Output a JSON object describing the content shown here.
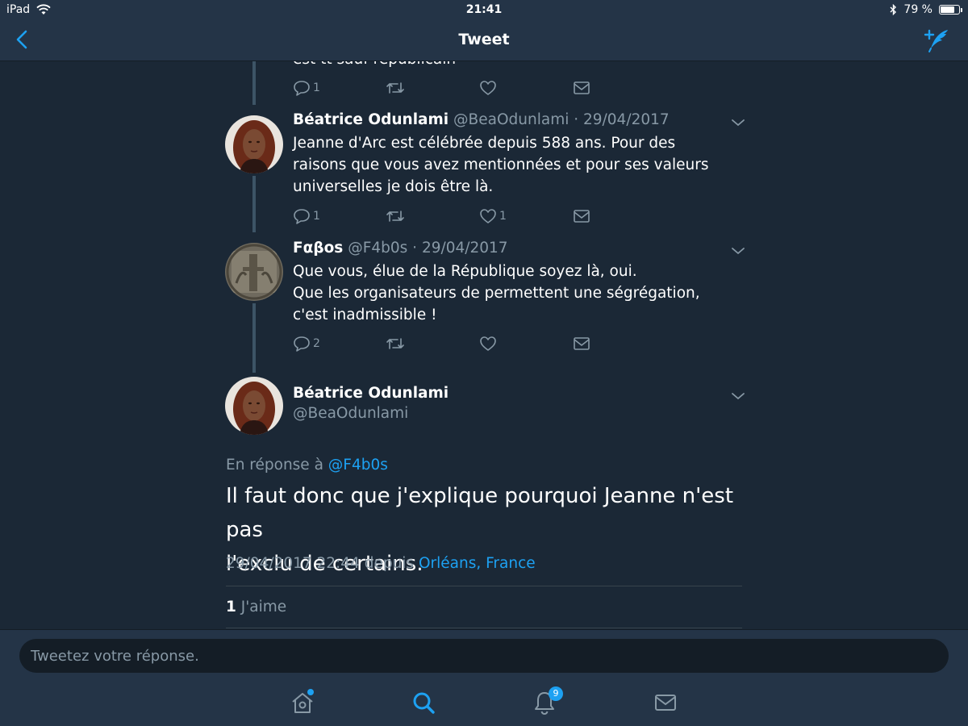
{
  "status_bar": {
    "device": "iPad",
    "time": "21:41",
    "battery": "79 %",
    "battery_level": 0.79
  },
  "nav": {
    "title": "Tweet",
    "back_icon": "chevron-left-icon",
    "compose_icon": "compose-tweet-icon"
  },
  "thread": {
    "partial_tweet": {
      "text": "est tt sauf républicain",
      "replies": "1",
      "retweets": "",
      "likes": ""
    },
    "tweets": [
      {
        "name": "Béatrice Odunlami",
        "handle": "@BeaOdunlami",
        "date": "29/04/2017",
        "lines": [
          "Jeanne d'Arc est célébrée depuis 588 ans. Pour des",
          "raisons que vous avez mentionnées et pour ses valeurs",
          "universelles je dois être là."
        ],
        "replies": "1",
        "retweets": "",
        "likes": "1"
      },
      {
        "name": "Fαβos",
        "handle": "@F4b0s",
        "date": "29/04/2017",
        "lines": [
          "Que vous, élue de la République soyez là, oui.",
          "Que les organisateurs de permettent une ségrégation,",
          "c'est inadmissible !"
        ],
        "replies": "2",
        "retweets": "",
        "likes": ""
      }
    ]
  },
  "main_tweet": {
    "name": "Béatrice Odunlami",
    "handle": "@BeaOdunlami",
    "reply_prefix": "En réponse à",
    "reply_handle": "@F4b0s",
    "text_line1": "Il faut donc que j'explique pourquoi Jeanne n'est pas",
    "text_line2": "l'exclu de certains.",
    "timestamp": "29/04/2017 22:44 depuis",
    "location": "Orléans, France",
    "like_count": "1",
    "like_label": "J'aime"
  },
  "composer": {
    "placeholder": "Tweetez votre réponse."
  },
  "tab_bar": {
    "notifications_badge": "9",
    "tabs": [
      "home-icon",
      "search-icon",
      "notifications-icon",
      "messages-icon"
    ]
  },
  "colors": {
    "background": "#1b2836",
    "bar": "#243447",
    "accent": "#1da1f2",
    "muted": "#8899a6"
  }
}
